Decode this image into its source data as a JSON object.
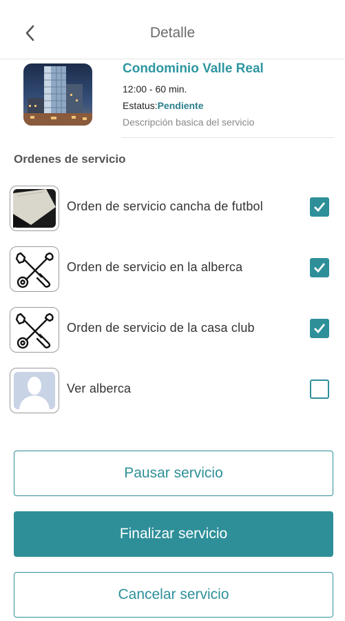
{
  "header": {
    "title": "Detalle",
    "back_icon": "chevron-left-icon"
  },
  "service": {
    "name": "Condominio Valle Real",
    "time": "12:00 - 60 min.",
    "status_label": "Estatus:",
    "status_value": "Pendiente",
    "description": "Descripción basica del servicio"
  },
  "orders": {
    "title": "Ordenes de servicio",
    "items": [
      {
        "label": "Orden de servicio cancha de futbol",
        "checked": true,
        "icon": "field-photo-icon"
      },
      {
        "label": "Orden de servicio en la alberca",
        "checked": true,
        "icon": "tools-icon"
      },
      {
        "label": "Orden de servicio de la casa club",
        "checked": true,
        "icon": "tools-icon"
      },
      {
        "label": "Ver alberca",
        "checked": false,
        "icon": "avatar-placeholder-icon"
      }
    ]
  },
  "actions": {
    "pause": "Pausar servicio",
    "finish": "Finalizar servicio",
    "cancel": "Cancelar servicio"
  },
  "colors": {
    "accent": "#2e8f99",
    "title": "#2e96a0"
  }
}
